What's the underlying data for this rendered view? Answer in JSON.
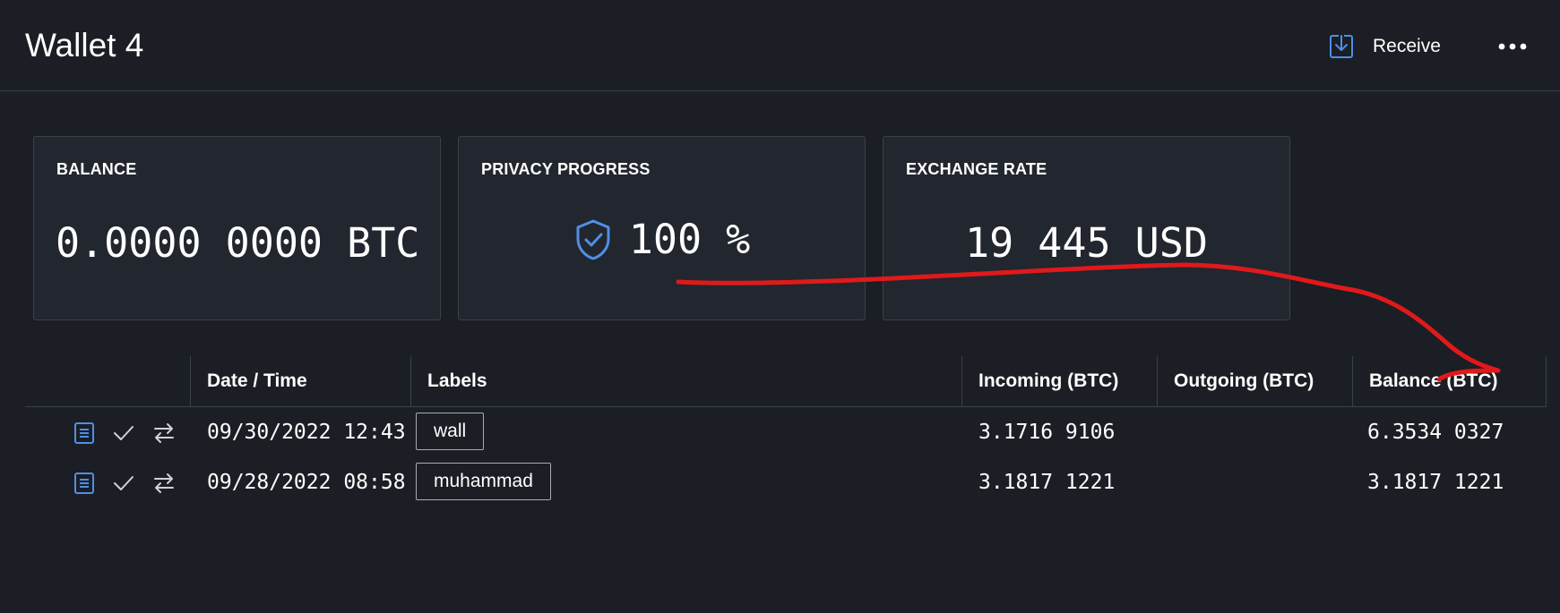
{
  "header": {
    "title": "Wallet 4",
    "receive_label": "Receive",
    "receive_icon": "download-icon",
    "more_icon": "more-horizontal-icon"
  },
  "cards": {
    "balance": {
      "title": "BALANCE",
      "value": "0.0000 0000 BTC"
    },
    "privacy": {
      "title": "PRIVACY PROGRESS",
      "value": "100 %",
      "icon": "shield-check-icon",
      "progress_percent": 100
    },
    "exchange": {
      "title": "EXCHANGE RATE",
      "value": "19 445 USD"
    }
  },
  "table": {
    "columns": [
      "Date / Time",
      "Labels",
      "Incoming (BTC)",
      "Outgoing (BTC)",
      "Balance (BTC)"
    ],
    "rows": [
      {
        "date": "09/30/2022 12:43",
        "label": "wall",
        "incoming": "3.1716 9106",
        "outgoing": "",
        "balance": "6.3534 0327"
      },
      {
        "date": "09/28/2022 08:58",
        "label": "muhammad",
        "incoming": "3.1817 1221",
        "outgoing": "",
        "balance": "3.1817 1221"
      }
    ],
    "row_icons": [
      "document-icon",
      "checkmark-icon",
      "transfer-arrows-icon"
    ]
  },
  "colors": {
    "background": "#1b1e24",
    "card": "#22262e",
    "accent_blue": "#4f8fe6",
    "annotation_red": "#e0191b"
  }
}
